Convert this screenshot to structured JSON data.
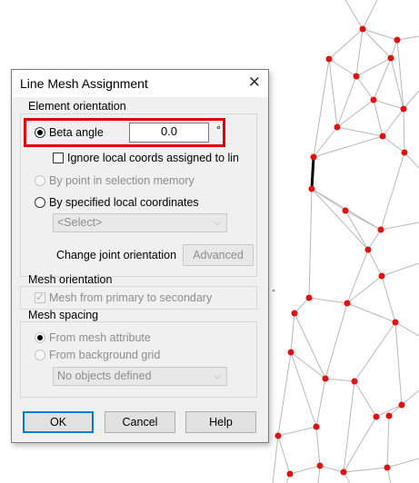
{
  "dialog": {
    "title": "Line Mesh Assignment",
    "close_icon": "close-icon"
  },
  "element_orientation": {
    "label": "Element orientation",
    "beta_angle": {
      "label": "Beta angle",
      "value": "0.0",
      "unit": "°",
      "selected": true
    },
    "ignore_local": {
      "label": "Ignore local coords assigned to line",
      "checked": false
    },
    "by_point": {
      "label": "By point in selection memory",
      "enabled": false
    },
    "by_local": {
      "label": "By specified local coordinates",
      "selected": false
    },
    "local_select": {
      "value": "<Select>",
      "enabled": false
    },
    "change_joint": {
      "label": "Change joint orientation",
      "button": "Advanced"
    }
  },
  "mesh_orientation": {
    "label": "Mesh orientation",
    "primary_to_secondary": {
      "label": "Mesh from primary to secondary",
      "checked": true,
      "enabled": false
    }
  },
  "mesh_spacing": {
    "label": "Mesh spacing",
    "from_attribute": {
      "label": "From mesh attribute",
      "selected": true,
      "enabled": false
    },
    "from_grid": {
      "label": "From background grid",
      "selected": false,
      "enabled": false
    },
    "grid_select": {
      "value": "No objects defined",
      "enabled": false
    }
  },
  "buttons": {
    "ok": "OK",
    "cancel": "Cancel",
    "help": "Help"
  },
  "colors": {
    "highlight": "#e00000",
    "node": "#e31010",
    "member": "#b8b8b8",
    "selected_member": "#000000"
  }
}
